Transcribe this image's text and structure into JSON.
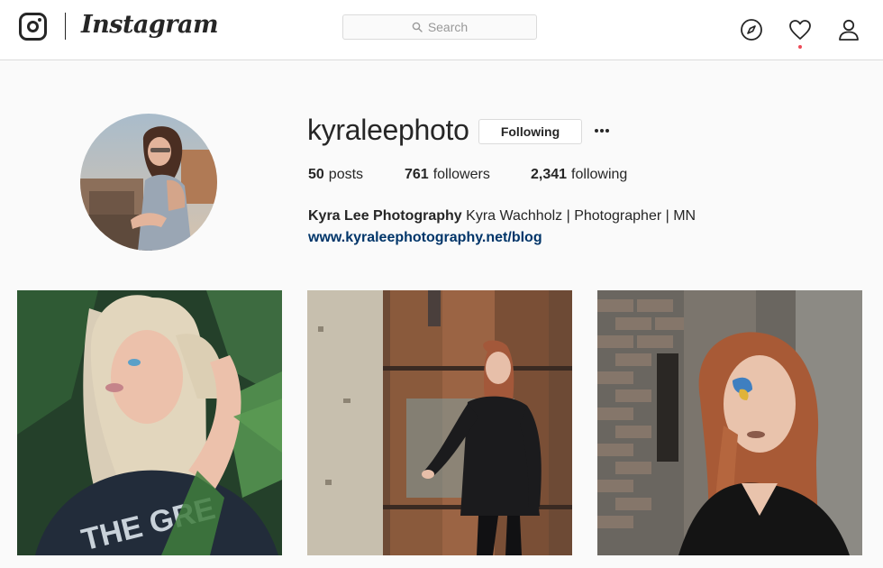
{
  "app": {
    "wordmark": "Instagram"
  },
  "search": {
    "placeholder": "Search"
  },
  "profile": {
    "username": "kyraleephoto",
    "follow_button": "Following",
    "stats": {
      "posts_count": "50",
      "posts_label": "posts",
      "followers_count": "761",
      "followers_label": "followers",
      "following_count": "2,341",
      "following_label": "following"
    },
    "full_name": "Kyra Lee Photography",
    "bio": "Kyra Wachholz | Photographer | MN",
    "website": "www.kyraleephotography.net/blog"
  },
  "nav_icons": [
    "instagram-camera-icon",
    "explore-compass-icon",
    "activity-heart-icon",
    "profile-person-icon"
  ],
  "colors": {
    "link": "#003569",
    "border": "#dbdbdb",
    "background": "#fafafa",
    "notification_dot": "#ed4956"
  },
  "posts": [
    {
      "alt": "photo-1"
    },
    {
      "alt": "photo-2"
    },
    {
      "alt": "photo-3"
    }
  ]
}
